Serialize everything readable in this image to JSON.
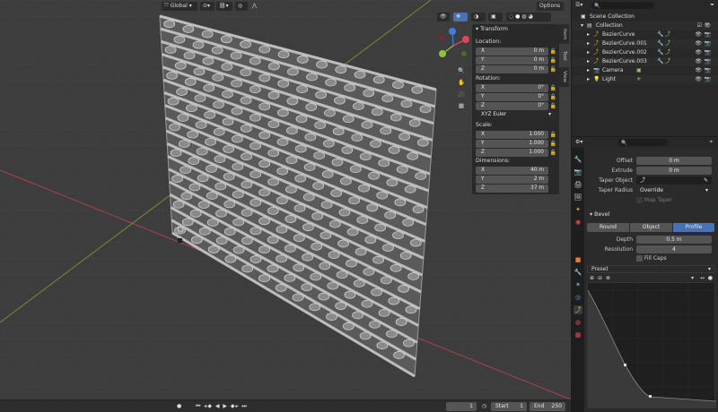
{
  "viewport": {
    "orientation_select": "Global",
    "options_label": "Options",
    "npanel": {
      "header": "Transform",
      "location_label": "Location:",
      "location": [
        {
          "axis": "X",
          "value": "0 m"
        },
        {
          "axis": "Y",
          "value": "0 m"
        },
        {
          "axis": "Z",
          "value": "0 m"
        }
      ],
      "rotation_label": "Rotation:",
      "rotation": [
        {
          "axis": "X",
          "value": "0°"
        },
        {
          "axis": "Y",
          "value": "0°"
        },
        {
          "axis": "Z",
          "value": "0°"
        }
      ],
      "rotation_mode": "XYZ Euler",
      "scale_label": "Scale:",
      "scale": [
        {
          "axis": "X",
          "value": "1.000"
        },
        {
          "axis": "Y",
          "value": "1.000"
        },
        {
          "axis": "Z",
          "value": "1.000"
        }
      ],
      "dimensions_label": "Dimensions:",
      "dimensions": [
        {
          "axis": "X",
          "value": "40 m"
        },
        {
          "axis": "Y",
          "value": "2 m"
        },
        {
          "axis": "Z",
          "value": "37 m"
        }
      ]
    },
    "sidetabs": [
      "Item",
      "Tool",
      "View"
    ],
    "gizmo": {
      "x": "X",
      "y": "Y",
      "z": "Z"
    }
  },
  "timeline": {
    "current_frame": "1",
    "start_label": "Start",
    "start": "1",
    "end_label": "End",
    "end": "250"
  },
  "outliner": {
    "root": "Scene Collection",
    "collection": "Collection",
    "items": [
      {
        "name": "BezierCurve",
        "type": "curve"
      },
      {
        "name": "BezierCurve.001",
        "type": "curve"
      },
      {
        "name": "BezierCurve.002",
        "type": "curve"
      },
      {
        "name": "BezierCurve.003",
        "type": "curve"
      },
      {
        "name": "Camera",
        "type": "camera"
      },
      {
        "name": "Light",
        "type": "light"
      }
    ]
  },
  "properties": {
    "offset_label": "Offset",
    "offset": "0 m",
    "extrude_label": "Extrude",
    "extrude": "0 m",
    "taper_label": "Taper Object",
    "taper_radius_label": "Taper Radius",
    "taper_radius": "Override",
    "map_taper_label": "Map Taper",
    "bevel_header": "Bevel",
    "bevel_modes": [
      "Round",
      "Object",
      "Profile"
    ],
    "bevel_active": "Profile",
    "depth_label": "Depth",
    "depth": "0.5 m",
    "resolution_label": "Resolution",
    "resolution": "4",
    "fill_caps_label": "Fill Caps",
    "preset_label": "Preset"
  },
  "colors": {
    "accent": "#4772b3",
    "axis_x": "#e04656",
    "axis_y": "#8fc33e",
    "axis_z": "#3d7ee0",
    "viewport_bg": "#3d3d3d"
  }
}
